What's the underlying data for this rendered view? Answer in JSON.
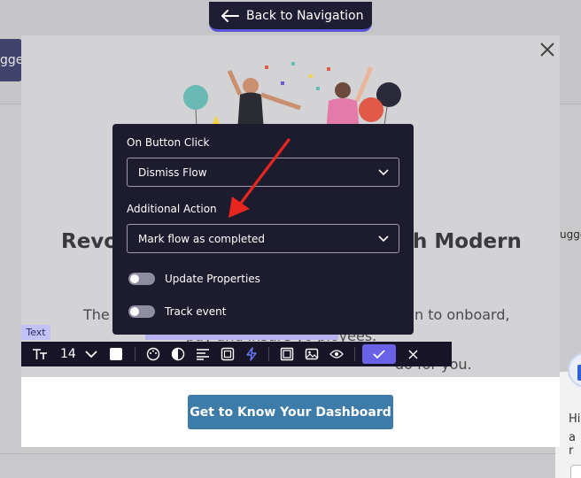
{
  "back_nav": {
    "label": "Back to Navigation"
  },
  "background": {
    "left_tab_text": "gges",
    "right_text": "ugge",
    "chat_line1": "Hi",
    "chat_line2": "a r"
  },
  "modal": {
    "heading_left": "Revo",
    "heading_right": "h Modern",
    "body_line1_left": "The A",
    "body_line1_right": "n to onboard,",
    "body_line2": "pay and insure yo      ployees.",
    "body_line3": "do for you.",
    "cta_label": "Get to Know Your Dashboard"
  },
  "text_tag": "Text",
  "toolbar": {
    "font_size": "14",
    "icons": [
      "text-type-icon",
      "chevron-down-icon",
      "color-swatch",
      "palette-icon",
      "contrast-icon",
      "align-icon",
      "frame-icon",
      "lightning-icon",
      "box-icon",
      "image-icon",
      "eye-icon",
      "check-icon",
      "close-icon"
    ]
  },
  "action_panel": {
    "on_click_label": "On Button Click",
    "on_click_value": "Dismiss Flow",
    "additional_label": "Additional Action",
    "additional_value": "Mark flow as completed",
    "toggle1_label": "Update Properties",
    "toggle2_label": "Track event"
  },
  "colors": {
    "panel_bg": "#1d1b2e",
    "accent": "#6961e6",
    "cta": "#3d7ba8",
    "arrow": "#e8261f"
  }
}
